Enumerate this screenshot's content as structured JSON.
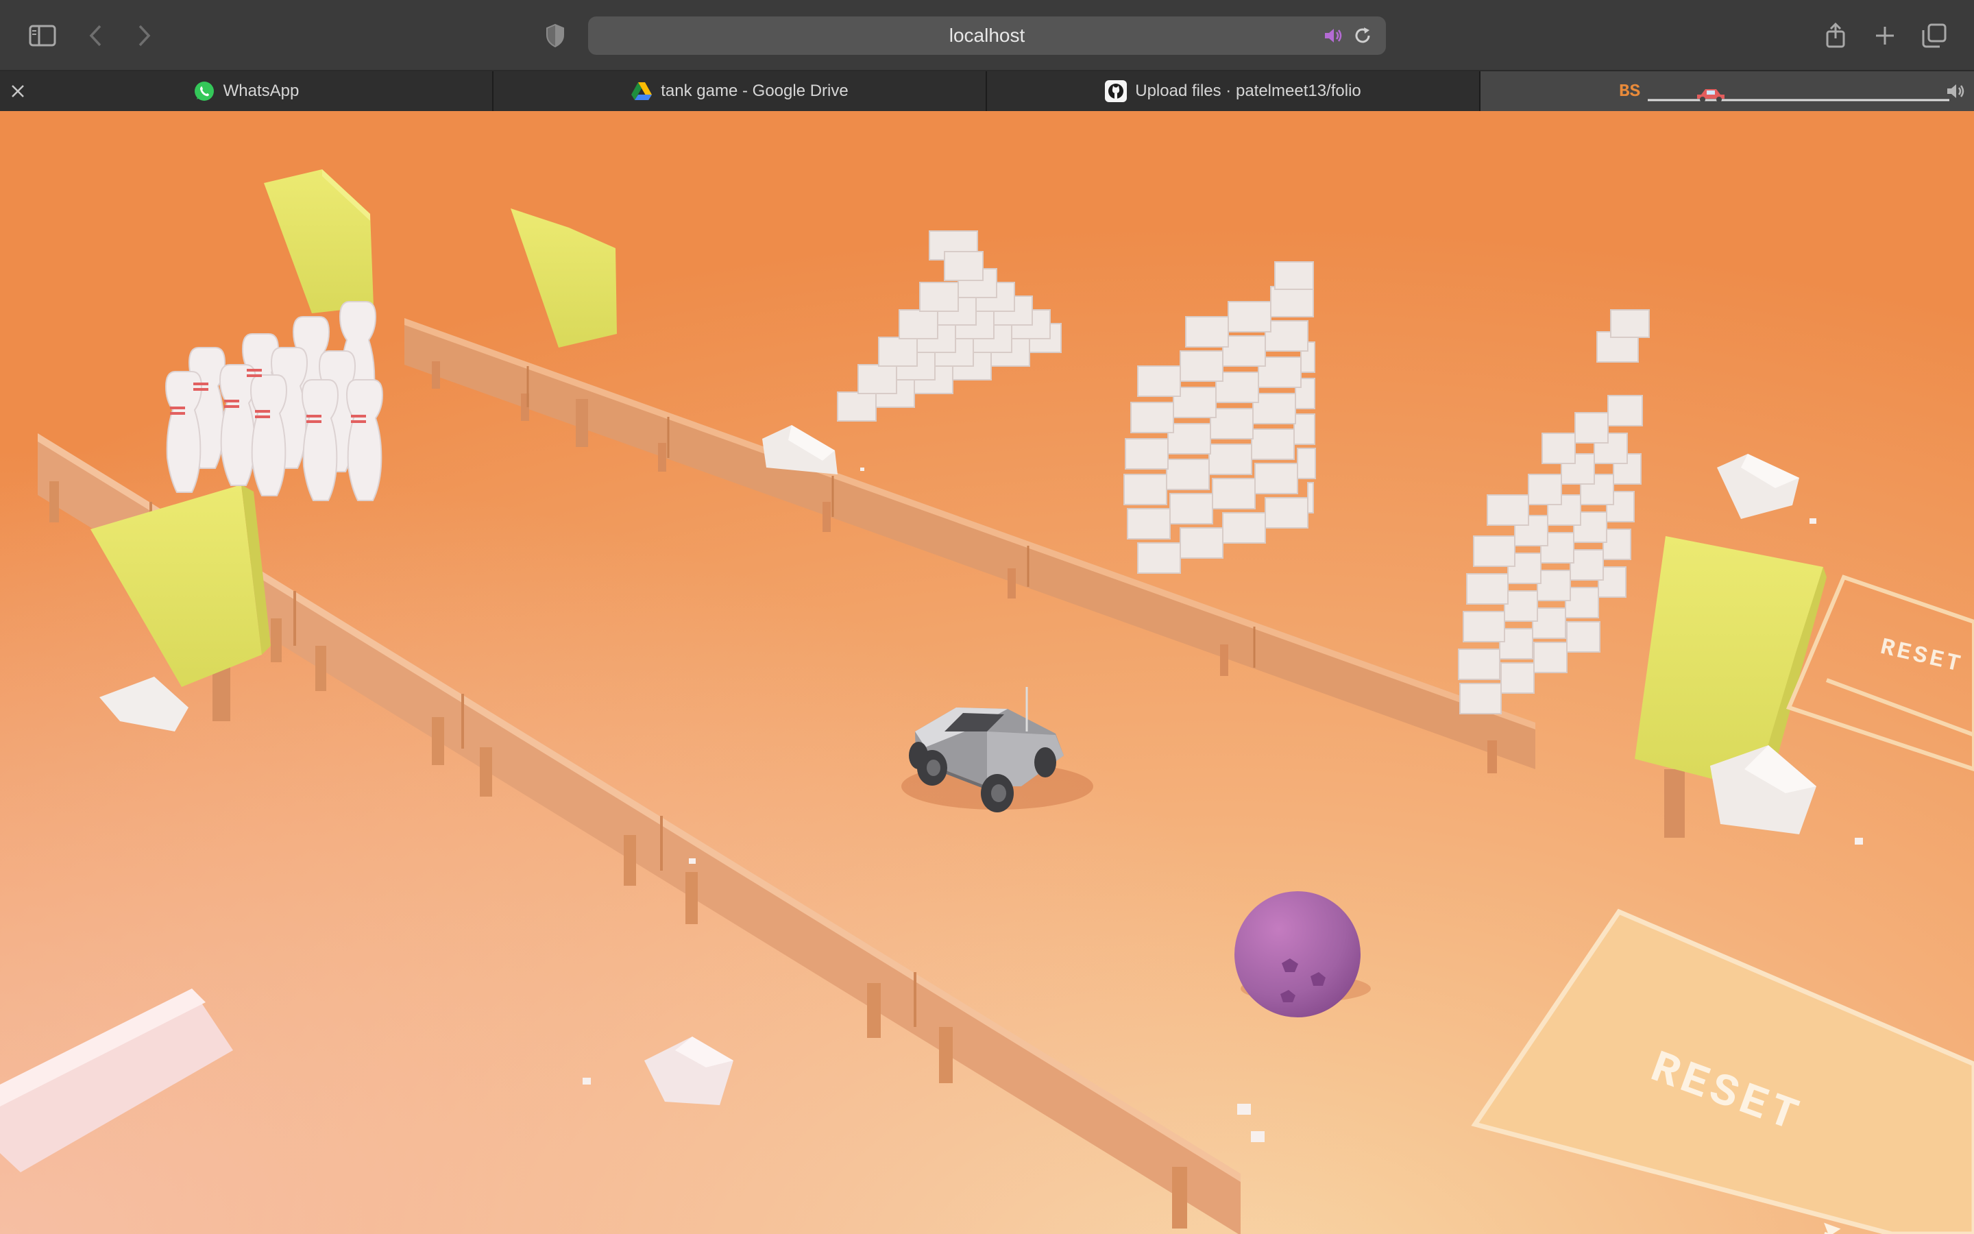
{
  "browser": {
    "url": "localhost",
    "tabs": [
      {
        "label": "WhatsApp",
        "icon": "whatsapp-icon"
      },
      {
        "label": "tank game - Google Drive",
        "icon": "google-drive-icon"
      },
      {
        "label": "Upload files · patelmeet13/folio",
        "icon": "github-icon"
      },
      {
        "label": "",
        "icon": "bs-favicon-icon",
        "badge": "BS"
      }
    ]
  },
  "game": {
    "reset_labels": [
      "RESET",
      "RESET"
    ],
    "colors": {
      "ground": "#f0904a",
      "ground_light": "#f6c896",
      "tree": "#e6e466",
      "fence": "#e5a270",
      "brick": "#efe8e6",
      "ball": "#a664a8",
      "car": "#8c8c90"
    }
  }
}
